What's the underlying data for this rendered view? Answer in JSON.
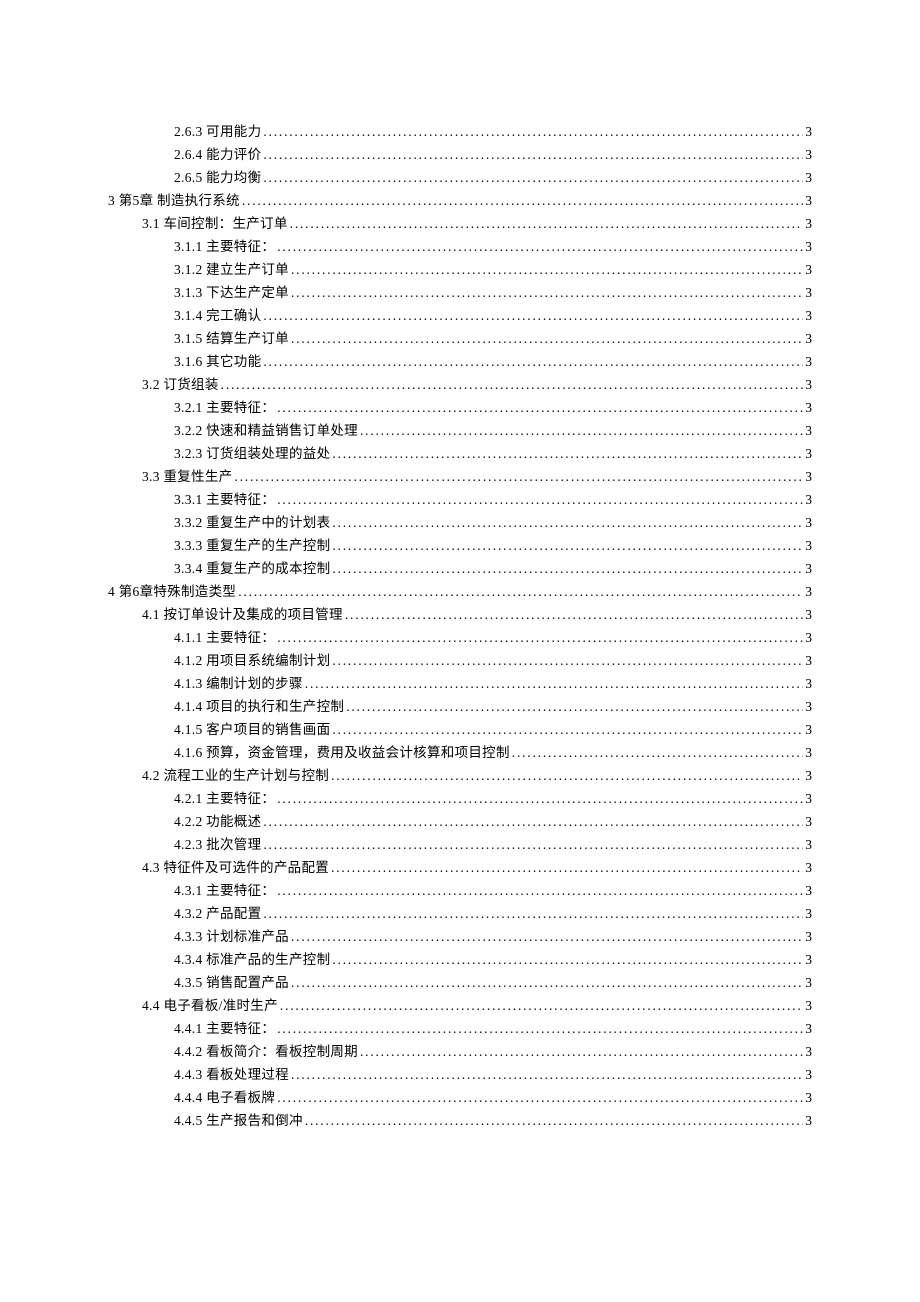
{
  "default_page": "3",
  "entries": [
    {
      "level": 3,
      "num": "2.6.3",
      "title": "可用能力",
      "page": "3"
    },
    {
      "level": 3,
      "num": "2.6.4",
      "title": "能力评价",
      "page": "3"
    },
    {
      "level": 3,
      "num": "2.6.5",
      "title": "能力均衡",
      "page": "3"
    },
    {
      "level": 1,
      "num": "3",
      "title": "第5章 制造执行系统",
      "page": "3"
    },
    {
      "level": 2,
      "num": "3.1",
      "title": "车间控制：生产订单",
      "page": "3"
    },
    {
      "level": 3,
      "num": "3.1.1",
      "title": "主要特征：",
      "page": "3"
    },
    {
      "level": 3,
      "num": "3.1.2",
      "title": "建立生产订单",
      "page": "3"
    },
    {
      "level": 3,
      "num": "3.1.3",
      "title": "下达生产定单",
      "page": "3"
    },
    {
      "level": 3,
      "num": "3.1.4",
      "title": "完工确认",
      "page": "3"
    },
    {
      "level": 3,
      "num": "3.1.5",
      "title": "结算生产订单",
      "page": "3"
    },
    {
      "level": 3,
      "num": "3.1.6",
      "title": "其它功能",
      "page": "3"
    },
    {
      "level": 2,
      "num": "3.2",
      "title": "订货组装",
      "page": "3"
    },
    {
      "level": 3,
      "num": "3.2.1",
      "title": "主要特征：",
      "page": "3"
    },
    {
      "level": 3,
      "num": "3.2.2",
      "title": "快速和精益销售订单处理",
      "page": "3"
    },
    {
      "level": 3,
      "num": "3.2.3",
      "title": "订货组装处理的益处",
      "page": "3"
    },
    {
      "level": 2,
      "num": "3.3",
      "title": "重复性生产",
      "page": "3"
    },
    {
      "level": 3,
      "num": "3.3.1",
      "title": "主要特征：",
      "page": "3"
    },
    {
      "level": 3,
      "num": "3.3.2",
      "title": "重复生产中的计划表",
      "page": "3"
    },
    {
      "level": 3,
      "num": "3.3.3",
      "title": "重复生产的生产控制",
      "page": "3"
    },
    {
      "level": 3,
      "num": "3.3.4",
      "title": "重复生产的成本控制",
      "page": "3"
    },
    {
      "level": 1,
      "num": "4",
      "title": "第6章特殊制造类型",
      "page": "3"
    },
    {
      "level": 2,
      "num": "4.1",
      "title": "按订单设计及集成的项目管理",
      "page": "3"
    },
    {
      "level": 3,
      "num": "4.1.1",
      "title": "主要特征：",
      "page": "3"
    },
    {
      "level": 3,
      "num": "4.1.2",
      "title": "用项目系统编制计划",
      "page": "3"
    },
    {
      "level": 3,
      "num": "4.1.3",
      "title": "编制计划的步骤",
      "page": "3"
    },
    {
      "level": 3,
      "num": "4.1.4",
      "title": "项目的执行和生产控制",
      "page": "3"
    },
    {
      "level": 3,
      "num": "4.1.5",
      "title": "客户项目的销售画面",
      "page": "3"
    },
    {
      "level": 3,
      "num": "4.1.6",
      "title": "预算，资金管理，费用及收益会计核算和项目控制",
      "page": "3"
    },
    {
      "level": 2,
      "num": "4.2",
      "title": "流程工业的生产计划与控制",
      "page": "3"
    },
    {
      "level": 3,
      "num": "4.2.1",
      "title": "主要特征：",
      "page": "3"
    },
    {
      "level": 3,
      "num": "4.2.2",
      "title": "功能概述",
      "page": "3"
    },
    {
      "level": 3,
      "num": "4.2.3",
      "title": "批次管理",
      "page": "3"
    },
    {
      "level": 2,
      "num": "4.3",
      "title": "特征件及可选件的产品配置",
      "page": "3"
    },
    {
      "level": 3,
      "num": "4.3.1",
      "title": "主要特征：",
      "page": "3"
    },
    {
      "level": 3,
      "num": "4.3.2",
      "title": "产品配置",
      "page": "3"
    },
    {
      "level": 3,
      "num": "4.3.3",
      "title": "计划标准产品",
      "page": "3"
    },
    {
      "level": 3,
      "num": "4.3.4",
      "title": "标准产品的生产控制",
      "page": "3"
    },
    {
      "level": 3,
      "num": "4.3.5",
      "title": "销售配置产品",
      "page": "3"
    },
    {
      "level": 2,
      "num": "4.4",
      "title": "电子看板/准时生产",
      "page": "3"
    },
    {
      "level": 3,
      "num": "4.4.1",
      "title": "主要特征：",
      "page": "3"
    },
    {
      "level": 3,
      "num": "4.4.2",
      "title": "看板简介：看板控制周期",
      "page": "3"
    },
    {
      "level": 3,
      "num": "4.4.3",
      "title": "看板处理过程",
      "page": "3"
    },
    {
      "level": 3,
      "num": "4.4.4",
      "title": "电子看板牌",
      "page": "3"
    },
    {
      "level": 3,
      "num": "4.4.5",
      "title": "生产报告和倒冲",
      "page": "3"
    }
  ]
}
